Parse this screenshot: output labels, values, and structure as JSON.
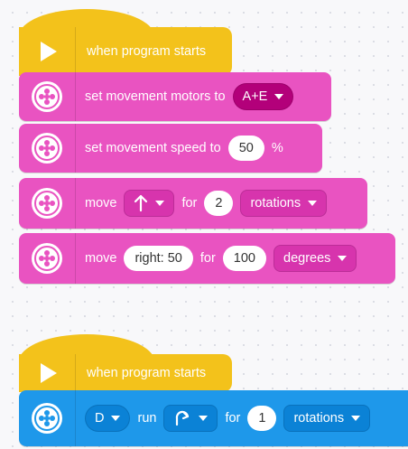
{
  "stack1": {
    "hat_label": "when program starts",
    "blocks": {
      "motors": {
        "text": "set movement motors to",
        "value": "A+E"
      },
      "speed": {
        "text": "set movement speed to",
        "value": "50",
        "unit": "%"
      },
      "move1": {
        "text": "move",
        "direction_icon": "arrow-up-icon",
        "for": "for",
        "value": "2",
        "unit": "rotations"
      },
      "move2": {
        "text": "move",
        "steer": "right: 50",
        "for": "for",
        "value": "100",
        "unit": "degrees"
      }
    }
  },
  "stack2": {
    "hat_label": "when program starts",
    "run_block": {
      "port": "D",
      "run": "run",
      "direction_icon": "clockwise-icon",
      "for": "for",
      "value": "1",
      "unit": "rotations"
    }
  },
  "colors": {
    "event_yellow": "#f3c21b",
    "movement_pink": "#e953c1",
    "motor_blue": "#1e98ea"
  },
  "icons": [
    "play-icon",
    "motor-icon",
    "dropdown-caret-icon"
  ]
}
